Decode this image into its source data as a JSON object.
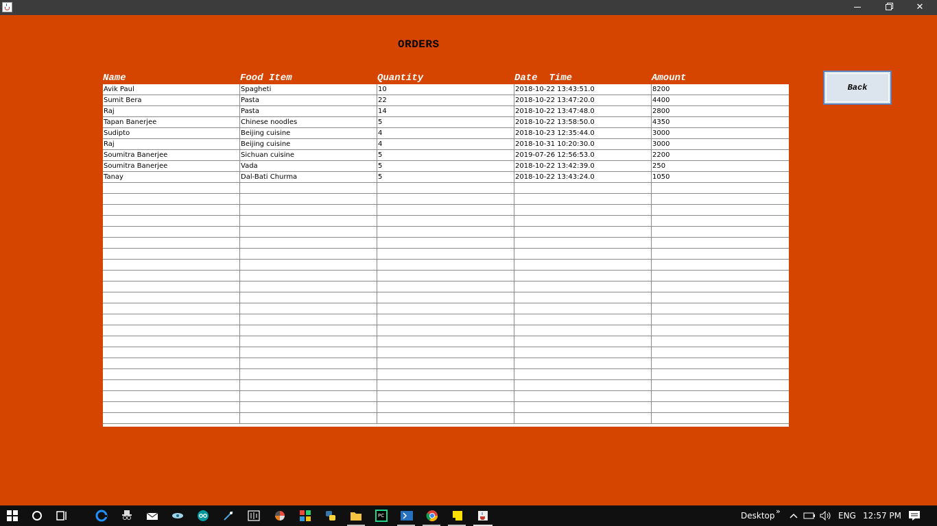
{
  "window": {
    "app_icon": "java-cup-icon",
    "controls": [
      "minimize-icon",
      "maximize-icon",
      "close-icon"
    ]
  },
  "page": {
    "title": "ORDERS",
    "back_label": "Back"
  },
  "table": {
    "columns": [
      "Name",
      "Food Item",
      "Quantity",
      "Date  Time",
      "Amount"
    ],
    "rows": [
      [
        "Avik Paul",
        "Spagheti",
        "10",
        "2018-10-22 13:43:51.0",
        "8200"
      ],
      [
        "Sumit Bera",
        "Pasta",
        "22",
        "2018-10-22 13:47:20.0",
        "4400"
      ],
      [
        "Raj",
        "Pasta",
        "14",
        "2018-10-22 13:47:48.0",
        "2800"
      ],
      [
        "Tapan Banerjee",
        "Chinese noodles",
        "5",
        "2018-10-22 13:58:50.0",
        "4350"
      ],
      [
        "Sudipto",
        "Beijing cuisine",
        "4",
        "2018-10-23 12:35:44.0",
        "3000"
      ],
      [
        "Raj",
        "Beijing cuisine",
        "4",
        "2018-10-31 10:20:30.0",
        "3000"
      ],
      [
        "Soumitra Banerjee",
        "Sichuan cuisine",
        "5",
        "2019-07-26 12:56:53.0",
        "2200"
      ],
      [
        "Soumitra Banerjee",
        "Vada",
        "5",
        "2018-10-22 13:42:39.0",
        "250"
      ],
      [
        "Tanay",
        "Dal-Bati Churma",
        "5",
        "2018-10-22 13:43:24.0",
        "1050"
      ]
    ],
    "empty_rows": 22
  },
  "taskbar": {
    "desktop_label": "Desktop",
    "overflow": "»",
    "language": "ENG",
    "time": "12:57 PM",
    "icons": [
      "windows-start-icon",
      "cortana-icon",
      "task-view-icon",
      "edge-icon",
      "incognito-icon",
      "mail-icon",
      "eye-icon",
      "arduino-icon",
      "paint-icon",
      "audio-editor-icon",
      "color-picker-icon",
      "office-icon",
      "python-icon",
      "file-explorer-icon",
      "pycharm-icon",
      "powershell-icon",
      "chrome-icon",
      "sticky-notes-icon",
      "java-icon"
    ]
  }
}
